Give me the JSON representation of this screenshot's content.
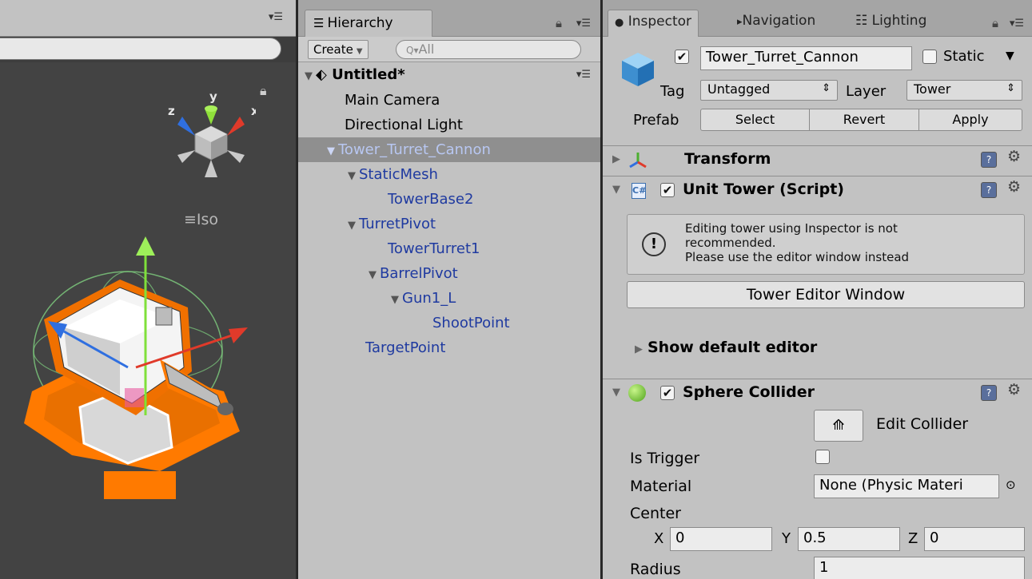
{
  "hierarchy": {
    "tab_label": "Hierarchy",
    "create_label": "Create",
    "search_placeholder": "All",
    "scene_name": "Untitled*",
    "items": [
      {
        "label": "Main Camera"
      },
      {
        "label": "Directional Light"
      },
      {
        "label": "Tower_Turret_Cannon"
      },
      {
        "label": "StaticMesh"
      },
      {
        "label": "TowerBase2"
      },
      {
        "label": "TurretPivot"
      },
      {
        "label": "TowerTurret1"
      },
      {
        "label": "BarrelPivot"
      },
      {
        "label": "Gun1_L"
      },
      {
        "label": "ShootPoint"
      },
      {
        "label": "TargetPoint"
      }
    ]
  },
  "scene_view": {
    "projection_label": "Iso",
    "axis_labels": {
      "x": "x",
      "y": "y",
      "z": "z"
    }
  },
  "inspector": {
    "tabs": [
      {
        "label": "Inspector",
        "icon": "info-icon"
      },
      {
        "label": "Navigation",
        "icon": "navigation-icon"
      },
      {
        "label": "Lighting",
        "icon": "lighting-icon"
      }
    ],
    "object_name": "Tower_Turret_Cannon",
    "static_label": "Static",
    "tag_label": "Tag",
    "tag_value": "Untagged",
    "layer_label": "Layer",
    "layer_value": "Tower",
    "prefab_label": "Prefab",
    "prefab_buttons": {
      "select": "Select",
      "revert": "Revert",
      "apply": "Apply"
    },
    "components": {
      "transform": "Transform",
      "unit_tower": "Unit Tower (Script)",
      "sphere_collider": "Sphere Collider"
    },
    "help_text": {
      "line1": "Editing tower using Inspector is not",
      "line2": "recommended.",
      "line3": "Please use the editor window instead"
    },
    "tower_editor_button": "Tower Editor Window",
    "show_default_editor": "Show default editor",
    "collider": {
      "edit_collider_label": "Edit Collider",
      "is_trigger_label": "Is Trigger",
      "material_label": "Material",
      "material_value": "None (Physic Materi",
      "center_label": "Center",
      "x_label": "X",
      "x_value": "0",
      "y_label": "Y",
      "y_value": "0.5",
      "z_label": "Z",
      "z_value": "0",
      "radius_label": "Radius",
      "radius_value": "1"
    }
  }
}
